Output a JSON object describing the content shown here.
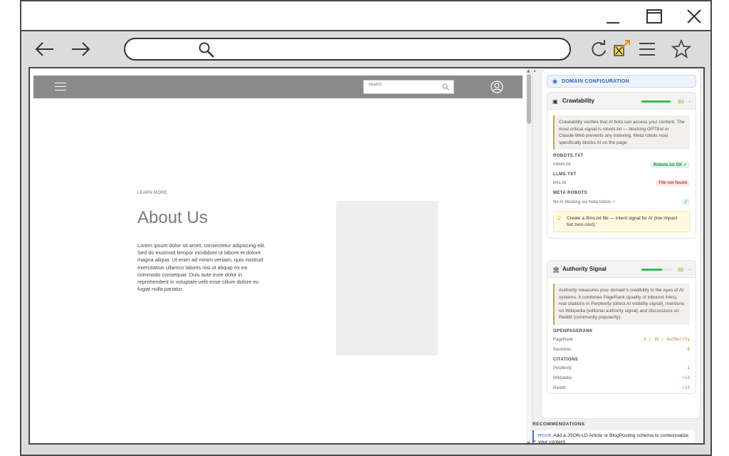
{
  "browser": {
    "address_value": "",
    "icons": [
      "minimize-icon",
      "maximize-icon",
      "close-icon",
      "back-arrow-icon",
      "forward-arrow-icon",
      "search-icon",
      "reload-icon",
      "extension-icon",
      "menu-icon",
      "bookmark-star-icon"
    ]
  },
  "site": {
    "search_placeholder": "Search",
    "learn_more": "LEARN MORE",
    "title": "About Us",
    "body": "Lorem ipsum dolor sit amet, consectetur adipiscing elit. Sed do eiusmod tempor incididunt ut labore et dolore magna aliqua. Ut enim ad minim veniam, quis nostrud exercitation ullamco laboris nisi ut aliquip ex ea commodo consequat. Duis aute irure dolor in reprehenderit in voluptate velit esse cillum dolore eu fugiat nulla pariatur."
  },
  "panel": {
    "domain_config": "DOMAIN CONFIGURATION",
    "crawlability": {
      "title": "Crawlability",
      "score": "93",
      "score_fraction": 0.93,
      "explain": "Crawlability verifies that AI bots can access your content. The most critical signal is robots.txt — blocking GPTBot or Claude-Web prevents any indexing. Meta robots noai specifically blocks AI on the page.",
      "robots_label": "ROBOTS.TXT",
      "robots_key": "robots.txt",
      "robots_status": "Robots.txt OK ✓",
      "llms_label": "LLMS.TXT",
      "llms_key": "llms.txt",
      "llms_status": "File not found",
      "meta_label": "META ROBOTS",
      "meta_key": "No AI blocking via meta robots ✓",
      "meta_status": "✓",
      "tip": "Create a /llms.txt file — intent signal for AI (low impact but zero cost)."
    },
    "authority": {
      "title": "Authority Signal",
      "score": "65",
      "score_fraction": 0.65,
      "explain": "Authority measures your domain's credibility in the eyes of AI systems. It combines PageRank (quality of inbound links), real citations in Perplexity (direct AI visibility signal), mentions on Wikipedia (editorial authority signal) and discussions on Reddit (community popularity).",
      "opr_label": "OPENPAGERANK",
      "pagerank_key": "PageRank",
      "pagerank_value": "5 / 10 — Authority",
      "backlinks_key": "Backlinks",
      "backlinks_value": "0",
      "citations_label": "CITATIONS",
      "perplexity_key": "Perplexity",
      "perplexity_value": "1",
      "wikipedia_key": "Wikipedia",
      "wikipedia_value": "+10",
      "reddit_key": "Reddit",
      "reddit_value": "+10"
    },
    "recommendations_label": "RECOMMENDATIONS",
    "recommendation": {
      "severity": "MEDIUM",
      "text": "Add a JSON-LD Article or BlogPosting schema to contextualize your content."
    }
  },
  "colors": {
    "accent": "#3d7bd8",
    "good": "#2fbf52",
    "score": "#b08a1a",
    "bad": "#cc3b2f"
  }
}
